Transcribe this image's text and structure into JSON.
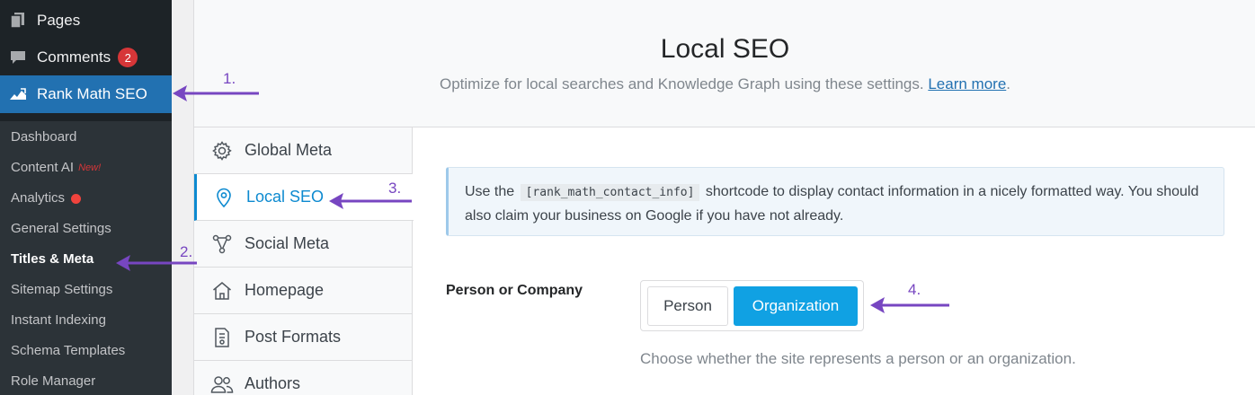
{
  "sidebar": {
    "top_items": [
      {
        "label": "Pages",
        "icon": "pages-icon"
      },
      {
        "label": "Comments",
        "icon": "comments-icon",
        "badge": "2"
      },
      {
        "label": "Rank Math SEO",
        "icon": "rank-math-icon"
      }
    ],
    "submenu": [
      {
        "label": "Dashboard"
      },
      {
        "label": "Content AI",
        "tag": "New!"
      },
      {
        "label": "Analytics"
      },
      {
        "label": "General Settings"
      },
      {
        "label": "Titles & Meta"
      },
      {
        "label": "Sitemap Settings"
      },
      {
        "label": "Instant Indexing"
      },
      {
        "label": "Schema Templates"
      },
      {
        "label": "Role Manager"
      }
    ]
  },
  "header": {
    "title": "Local SEO",
    "subtitle": "Optimize for local searches and Knowledge Graph using these settings.",
    "learn_more": "Learn more",
    "period": "."
  },
  "tabs": [
    {
      "label": "Global Meta",
      "icon": "gear-icon"
    },
    {
      "label": "Local SEO",
      "icon": "location-pin-icon"
    },
    {
      "label": "Social Meta",
      "icon": "share-icon"
    },
    {
      "label": "Homepage",
      "icon": "home-icon"
    },
    {
      "label": "Post Formats",
      "icon": "document-icon"
    },
    {
      "label": "Authors",
      "icon": "users-icon"
    }
  ],
  "notice": {
    "before": "Use the",
    "code": "[rank_math_contact_info]",
    "after": "shortcode to display contact information in a nicely formatted way. You should also claim your business on Google if you have not already."
  },
  "field": {
    "label": "Person or Company",
    "options": [
      "Person",
      "Organization"
    ],
    "selected": "Organization",
    "description": "Choose whether the site represents a person or an organization."
  },
  "annotations": [
    "1.",
    "2.",
    "3.",
    "4."
  ],
  "colors": {
    "sidebar_bg": "#1d2327",
    "submenu_bg": "#2c3338",
    "wp_blue": "#2271b1",
    "accent_blue": "#10a1e3",
    "annotation_purple": "#7746c1",
    "badge_red": "#d63638"
  }
}
